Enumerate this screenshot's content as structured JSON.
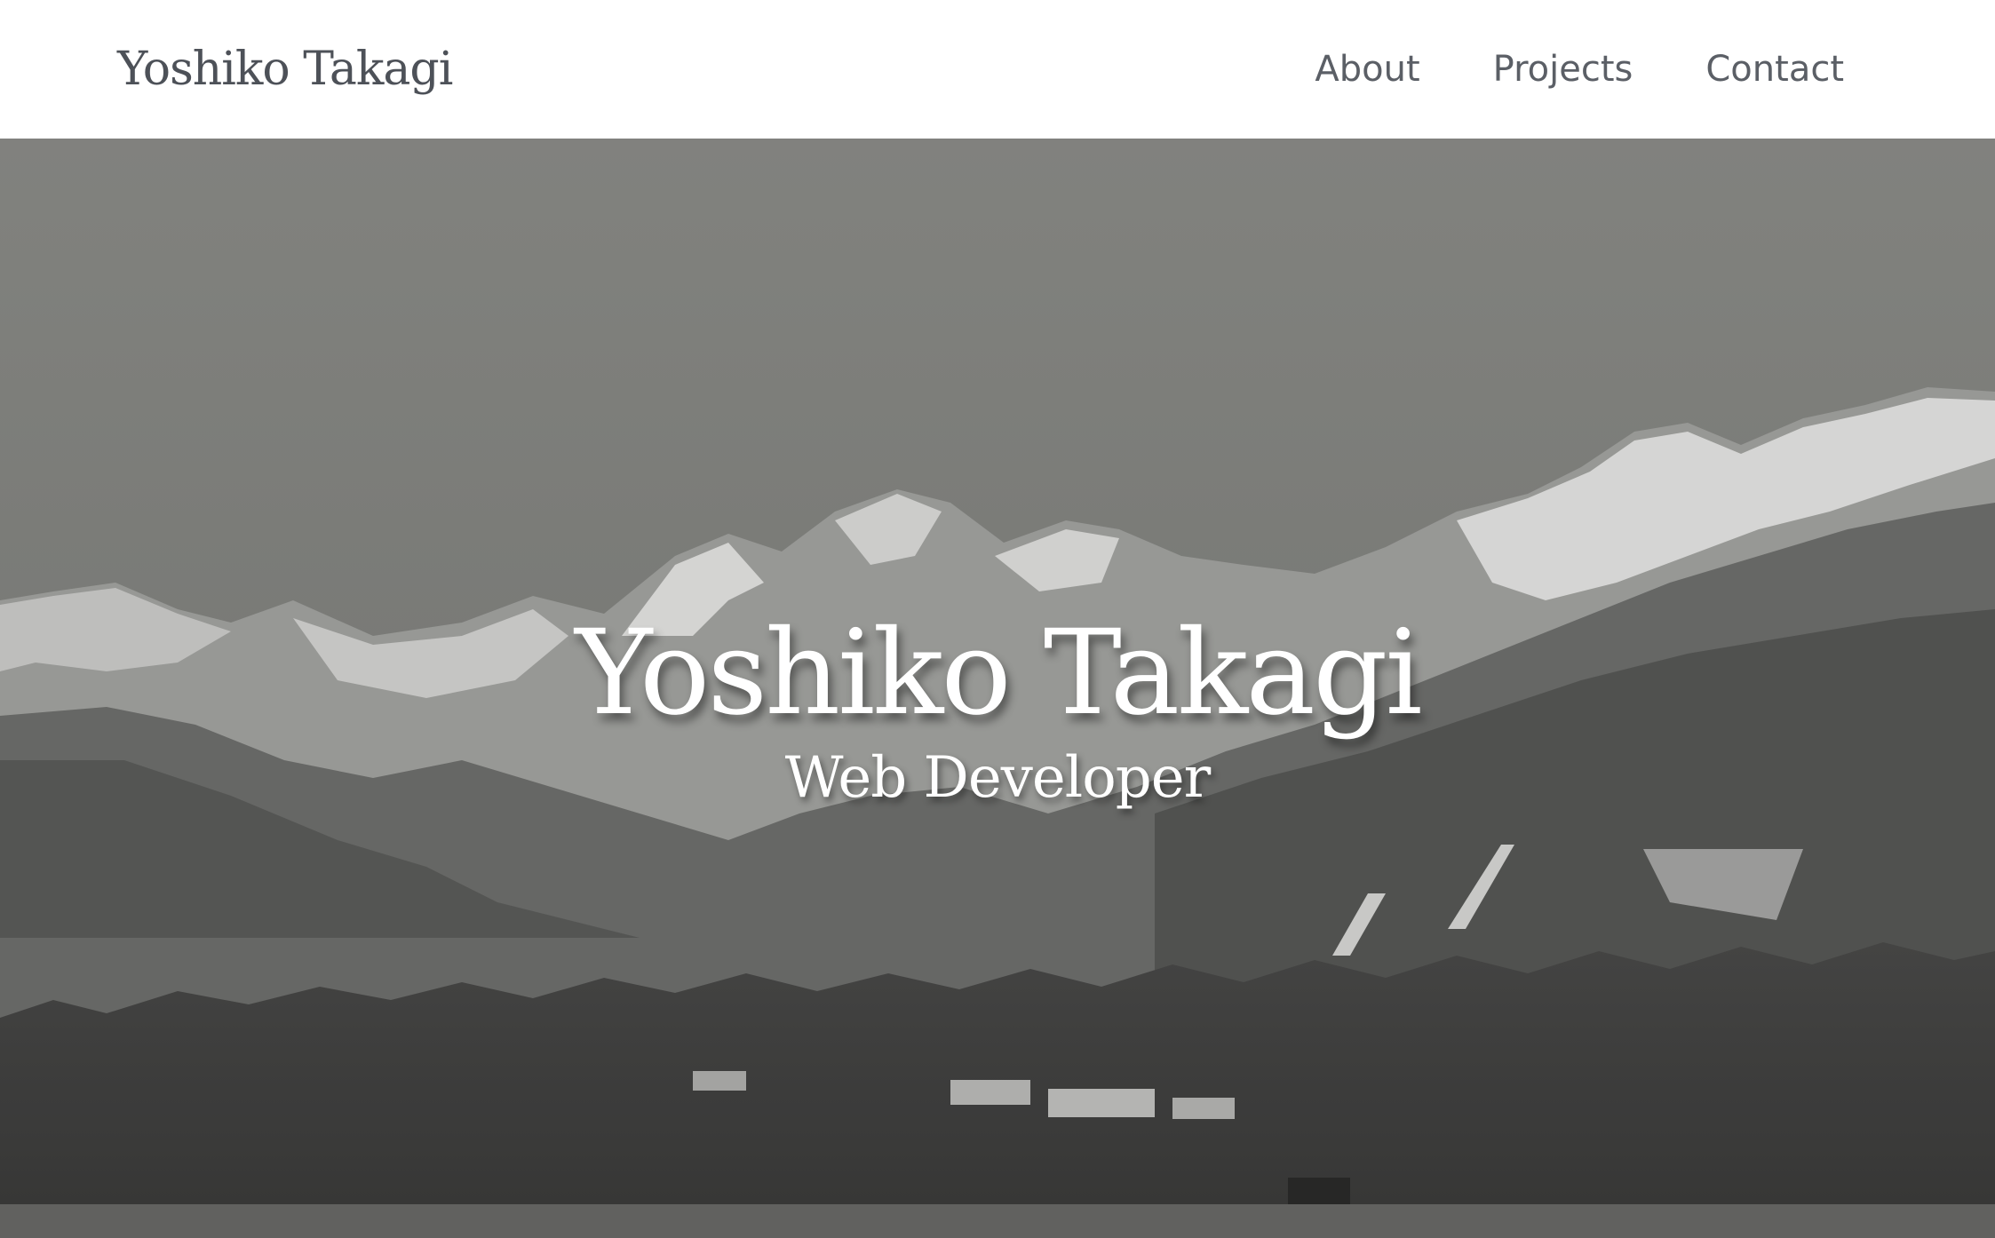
{
  "header": {
    "brand": "Yoshiko Takagi",
    "nav": [
      {
        "label": "About"
      },
      {
        "label": "Projects"
      },
      {
        "label": "Contact"
      }
    ]
  },
  "hero": {
    "title": "Yoshiko Takagi",
    "subtitle": "Web Developer"
  },
  "colors": {
    "header_background": "#ffffff",
    "brand_text": "#4d5158",
    "nav_text": "#5b5f66",
    "hero_text": "#ffffff",
    "sky": "#8a8b87"
  }
}
